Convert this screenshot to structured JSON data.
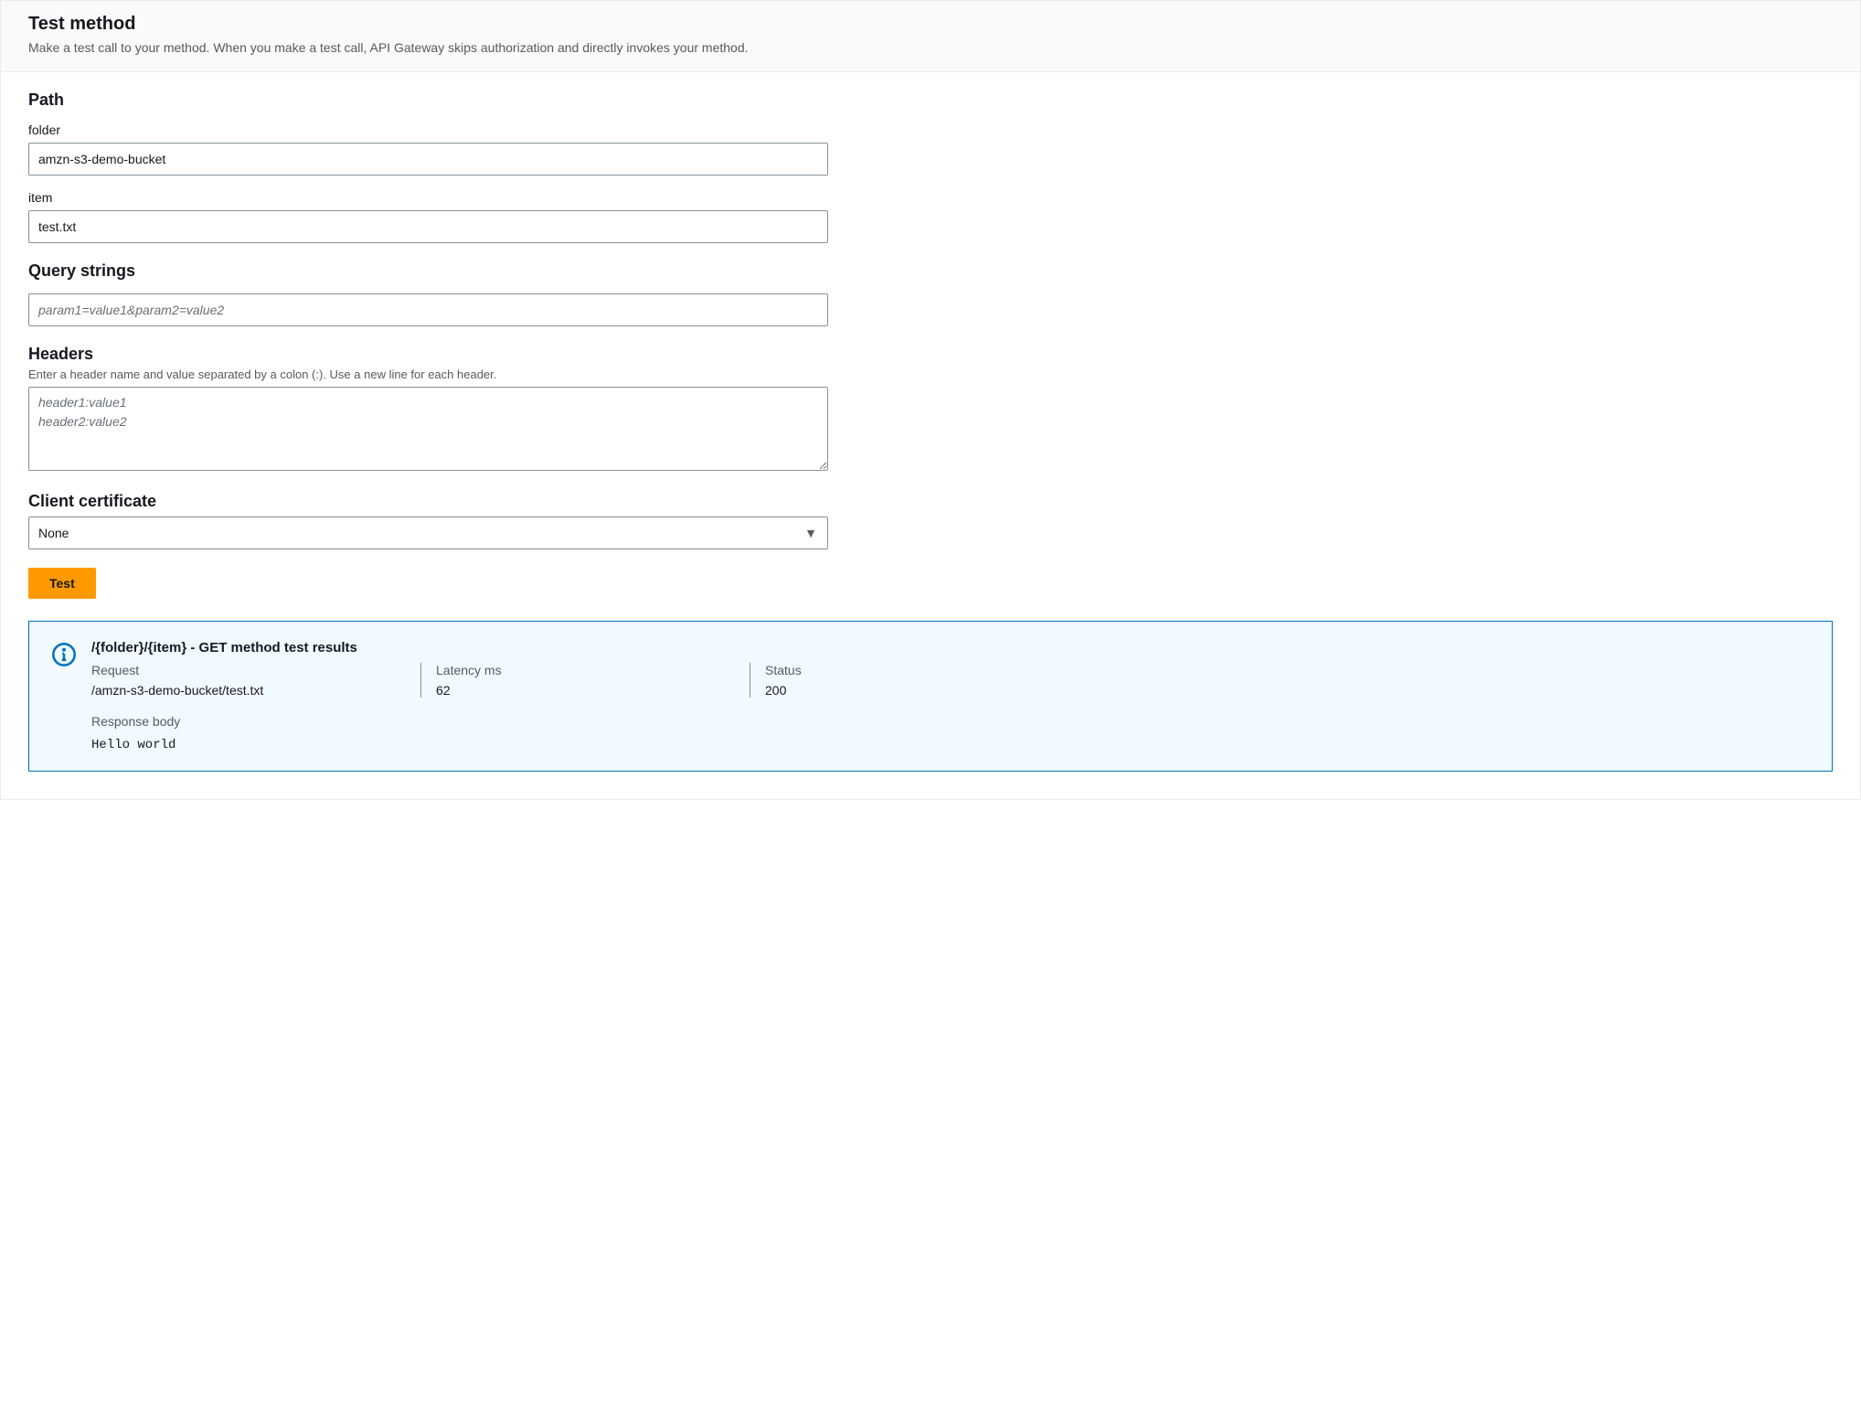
{
  "header": {
    "title": "Test method",
    "description": "Make a test call to your method. When you make a test call, API Gateway skips authorization and directly invokes your method."
  },
  "path": {
    "title": "Path",
    "fields": {
      "folder": {
        "label": "folder",
        "value": "amzn-s3-demo-bucket"
      },
      "item": {
        "label": "item",
        "value": "test.txt"
      }
    }
  },
  "query_strings": {
    "title": "Query strings",
    "placeholder": "param1=value1&param2=value2",
    "value": ""
  },
  "headers": {
    "title": "Headers",
    "description": "Enter a header name and value separated by a colon (:). Use a new line for each header.",
    "placeholder": "header1:value1\nheader2:value2",
    "value": ""
  },
  "client_certificate": {
    "title": "Client certificate",
    "selected": "None"
  },
  "test_button": {
    "label": "Test"
  },
  "results": {
    "title": "/{folder}/{item} - GET method test results",
    "request": {
      "label": "Request",
      "value": "/amzn-s3-demo-bucket/test.txt"
    },
    "latency": {
      "label": "Latency ms",
      "value": "62"
    },
    "status": {
      "label": "Status",
      "value": "200"
    },
    "response_body": {
      "label": "Response body",
      "value": "Hello world"
    }
  }
}
